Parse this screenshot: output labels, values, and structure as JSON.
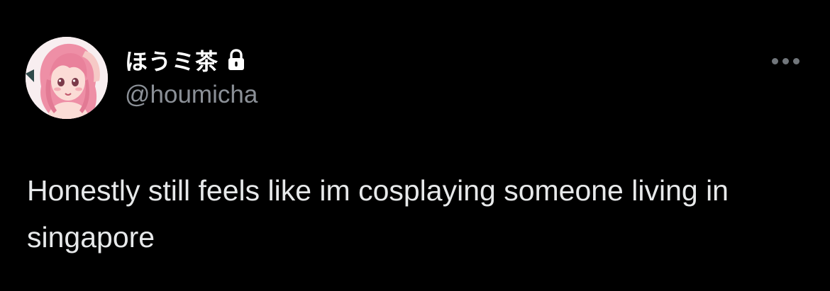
{
  "author": {
    "display_name": "ほうミ茶",
    "handle": "@houmicha",
    "protected_icon": "lock-icon",
    "avatar_icon": "avatar-illustration"
  },
  "menu": {
    "icon": "more-horizontal-icon"
  },
  "tweet": {
    "text": "Honestly still feels like im cosplaying someone living in singapore"
  },
  "colors": {
    "background": "#000000",
    "name": "#ffffff",
    "handle": "#8b9097",
    "text": "#e7e9ea",
    "menu_dots": "#71767b"
  }
}
